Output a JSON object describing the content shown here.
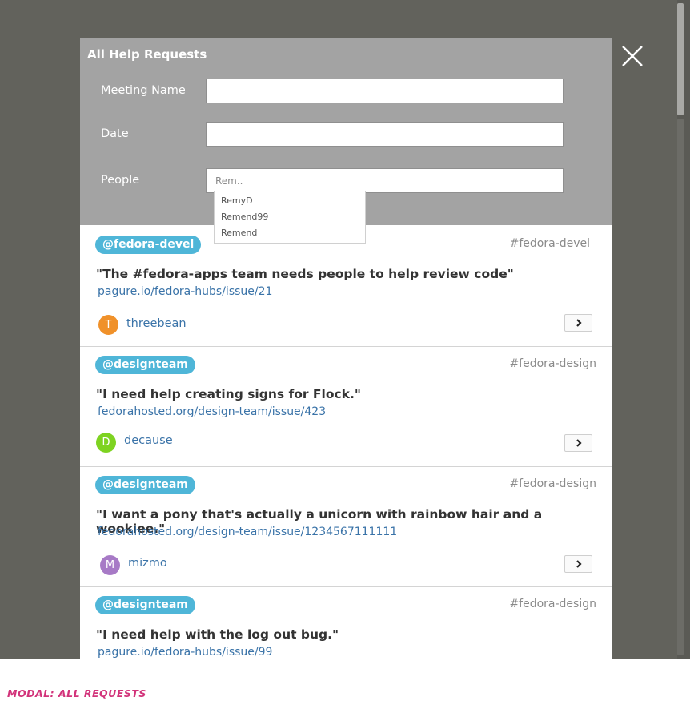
{
  "modal": {
    "title": "All Help Requests",
    "form": {
      "meeting_name_label": "Meeting Name",
      "meeting_name_value": "",
      "date_label": "Date",
      "date_value": "",
      "people_label": "People",
      "people_value": "Rem..",
      "suggestions": [
        "RemyD",
        "Remend99",
        "Remend"
      ]
    },
    "requests": [
      {
        "tag": "@fedora-devel",
        "channel": "#fedora-devel",
        "quote": "\"The #fedora-apps team needs people to help review code\"",
        "link": "pagure.io/fedora-hubs/issue/21",
        "avatar_letter": "T",
        "avatar_color": "#f0912a",
        "user": "threebean"
      },
      {
        "tag": "@designteam",
        "channel": "#fedora-design",
        "quote": "\"I need help creating signs for Flock.\"",
        "link": "fedorahosted.org/design-team/issue/423",
        "avatar_letter": "D",
        "avatar_color": "#7ed321",
        "user": "decause"
      },
      {
        "tag": "@designteam",
        "channel": "#fedora-design",
        "quote": "\"I want a pony that's actually a unicorn with rainbow hair and a wookiee.\"",
        "link": "fedorahosted.org/design-team/issue/1234567111111",
        "avatar_letter": "M",
        "avatar_color": "#a77ac6",
        "user": "mizmo"
      },
      {
        "tag": "@designteam",
        "channel": "#fedora-design",
        "quote": "\"I need help with the log out bug.\"",
        "link": "pagure.io/fedora-hubs/issue/99"
      }
    ]
  },
  "caption": "MODAL: ALL REQUESTS",
  "colors": {
    "backdrop": "#62625c",
    "header": "#a3a3a3",
    "tag_badge": "#4fb6d8",
    "link": "#3a73a8",
    "caption": "#d2337a"
  },
  "icons": {
    "close": "close-icon",
    "arrow": "chevron-right-icon"
  }
}
